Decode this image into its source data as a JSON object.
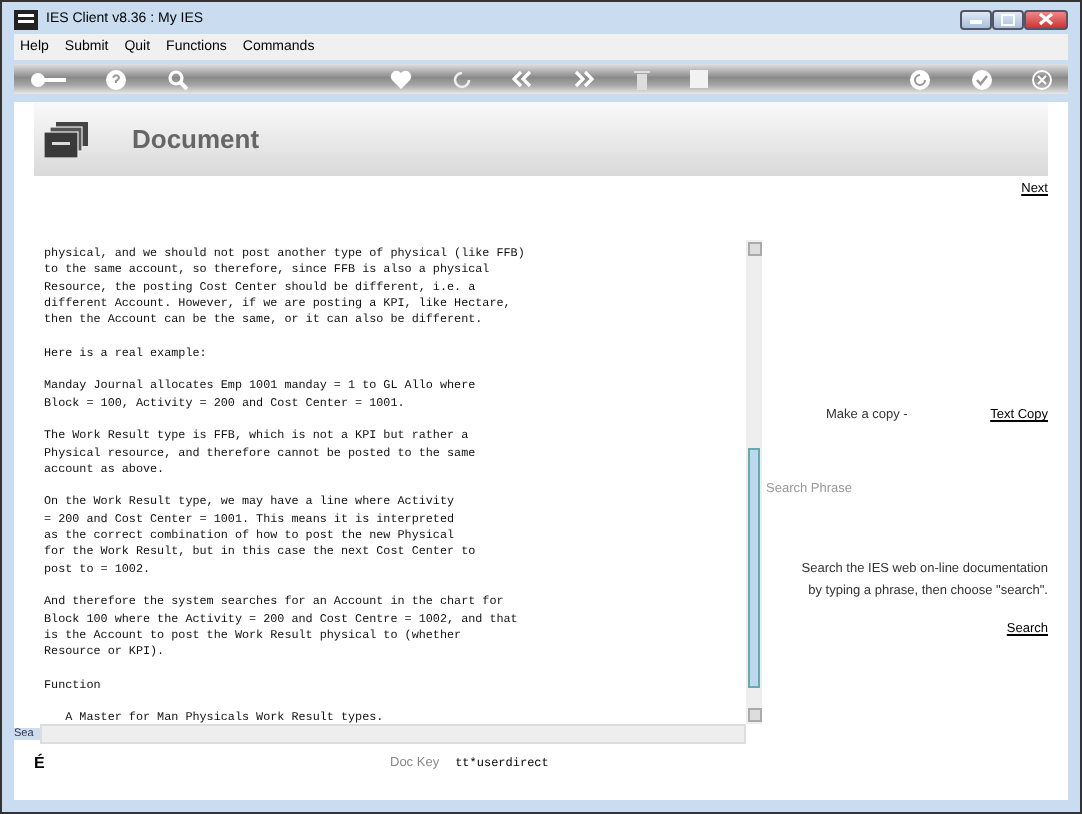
{
  "window": {
    "title": "IES Client v8.36 : My IES"
  },
  "menu": [
    "Help",
    "Submit",
    "Quit",
    "Functions",
    "Commands"
  ],
  "header": {
    "title": "Document"
  },
  "next_link": "Next",
  "document": {
    "paragraphs": [
      "physical, and we should not post another type of physical (like FFB)\nto the same account, so therefore, since FFB is also a physical\nResource, the posting Cost Center should be different, i.e. a\ndifferent Account. However, if we are posting a KPI, like Hectare,\nthen the Account can be the same, or it can also be different.",
      "Here is a real example:",
      "Manday Journal allocates Emp 1001 manday = 1 to GL Allo where\nBlock = 100, Activity = 200 and Cost Center = 1001.",
      "The Work Result type is FFB, which is not a KPI but rather a\nPhysical resource, and therefore cannot be posted to the same\naccount as above.",
      "On the Work Result type, we may have a line where Activity\n= 200 and Cost Center = 1001. This means it is interpreted\nas the correct combination of how to post the new Physical\nfor the Work Result, but in this case the next Cost Center to\npost to = 1002.",
      "And therefore the system searches for an Account in the chart for\nBlock 100 where the Activity = 200 and Cost Centre = 1002, and that\nis the Account to post the Work Result physical to (whether\nResource or KPI).",
      "Function",
      "   A Master for Man Physicals Work Result types."
    ]
  },
  "side_fragments": [
    "Sea",
    "É"
  ],
  "doc_key": {
    "label": "Doc Key",
    "value": "tt*userdirect"
  },
  "copy": {
    "label": "Make a copy -",
    "link": "Text Copy"
  },
  "search": {
    "placeholder": "Search Phrase",
    "description": "Search the IES web on-line documentation\nby typing a phrase, then choose \"search\".",
    "link": "Search"
  }
}
